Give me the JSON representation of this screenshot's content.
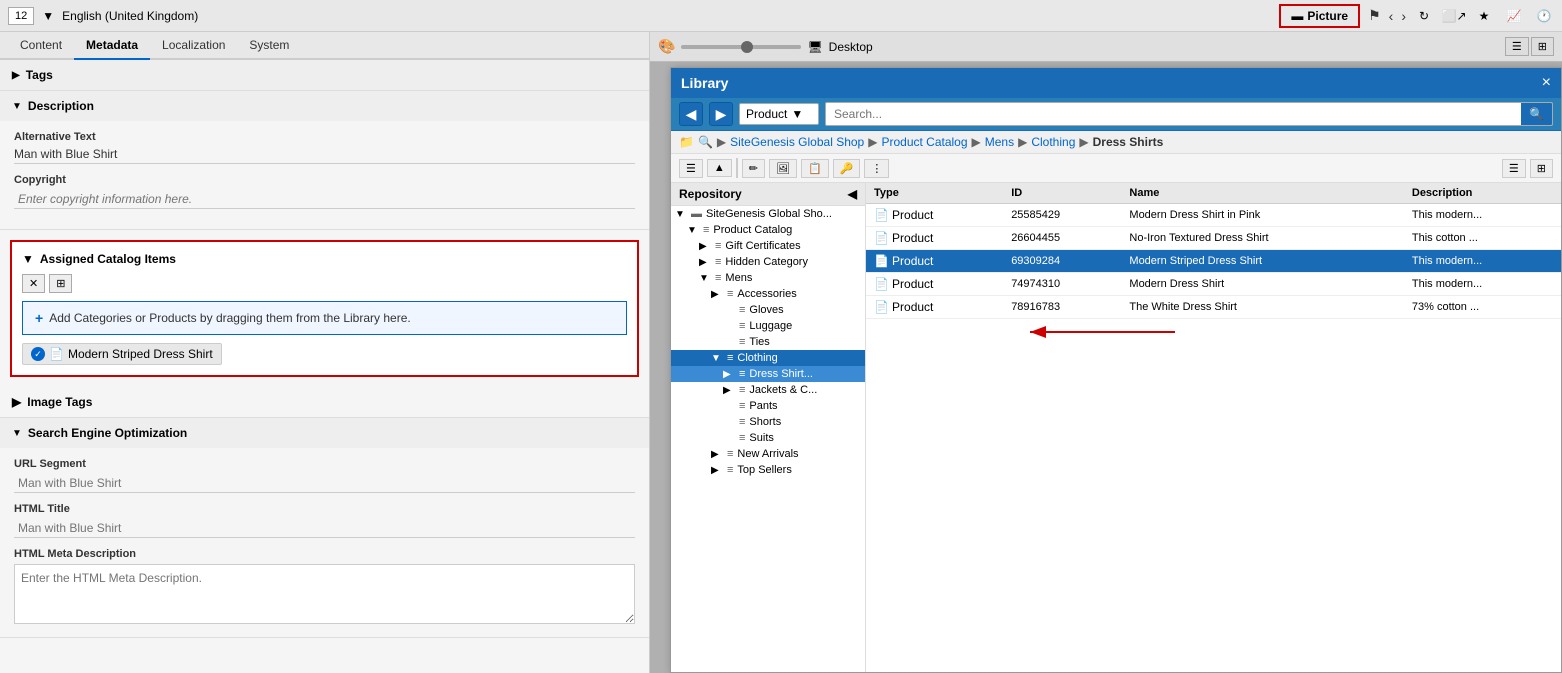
{
  "topbar": {
    "page_num": "12",
    "lang": "English (United Kingdom)",
    "picture_label": "Picture",
    "desktop_label": "Desktop"
  },
  "tabs": {
    "items": [
      "Content",
      "Metadata",
      "Localization",
      "System"
    ],
    "active": "Metadata"
  },
  "tags_section": {
    "label": "Tags",
    "collapsed": true
  },
  "description_section": {
    "label": "Description",
    "alt_text_label": "Alternative Text",
    "alt_text_value": "Man with Blue Shirt",
    "copyright_label": "Copyright",
    "copyright_placeholder": "Enter copyright information here."
  },
  "assigned_catalog": {
    "label": "Assigned Catalog Items",
    "drop_placeholder": "Add Categories or Products by dragging them from the Library here.",
    "tag_label": "Modern Striped Dress Shirt"
  },
  "image_tags": {
    "label": "Image Tags"
  },
  "seo": {
    "label": "Search Engine Optimization",
    "url_segment_label": "URL Segment",
    "url_segment_placeholder": "Man with Blue Shirt",
    "html_title_label": "HTML Title",
    "html_title_placeholder": "Man with Blue Shirt",
    "html_meta_label": "HTML Meta Description",
    "html_meta_placeholder": "Enter the HTML Meta Description."
  },
  "library": {
    "title": "Library",
    "close": "×",
    "search_placeholder": "Search...",
    "dropdown_label": "Product",
    "breadcrumb": [
      "SiteGenesis Global Shop",
      "Product Catalog",
      "Mens",
      "Clothing",
      "Dress Shirts"
    ],
    "repo_header": "Repository",
    "tree": [
      {
        "label": "SiteGenesis Global Sho...",
        "indent": 0,
        "expanded": true,
        "icon": "▼",
        "type": "store"
      },
      {
        "label": "Product Catalog",
        "indent": 1,
        "expanded": true,
        "icon": "▼",
        "type": "list"
      },
      {
        "label": "Gift Certificates",
        "indent": 2,
        "expanded": false,
        "icon": "▶",
        "type": "list"
      },
      {
        "label": "Hidden Category",
        "indent": 2,
        "expanded": false,
        "icon": "▶",
        "type": "list"
      },
      {
        "label": "Mens",
        "indent": 2,
        "expanded": true,
        "icon": "▼",
        "type": "list"
      },
      {
        "label": "Accessories",
        "indent": 3,
        "expanded": false,
        "icon": "▶",
        "type": "list"
      },
      {
        "label": "Gloves",
        "indent": 4,
        "expanded": false,
        "icon": "",
        "type": "list"
      },
      {
        "label": "Luggage",
        "indent": 4,
        "expanded": false,
        "icon": "",
        "type": "list"
      },
      {
        "label": "Ties",
        "indent": 4,
        "expanded": false,
        "icon": "",
        "type": "list"
      },
      {
        "label": "Clothing",
        "indent": 3,
        "expanded": true,
        "icon": "▼",
        "type": "list",
        "selected": true
      },
      {
        "label": "Dress Shirts",
        "indent": 4,
        "expanded": true,
        "icon": "▶",
        "type": "list",
        "active": true
      },
      {
        "label": "Jackets & C...",
        "indent": 4,
        "expanded": false,
        "icon": "▶",
        "type": "list"
      },
      {
        "label": "Pants",
        "indent": 4,
        "expanded": false,
        "icon": "",
        "type": "list"
      },
      {
        "label": "Shorts",
        "indent": 4,
        "expanded": false,
        "icon": "",
        "type": "list"
      },
      {
        "label": "Suits",
        "indent": 4,
        "expanded": false,
        "icon": "",
        "type": "list"
      },
      {
        "label": "New Arrivals",
        "indent": 3,
        "expanded": false,
        "icon": "▶",
        "type": "list"
      },
      {
        "label": "Top Sellers",
        "indent": 3,
        "expanded": false,
        "icon": "▶",
        "type": "list"
      }
    ],
    "columns": [
      "Type",
      "ID",
      "Name",
      "Description"
    ],
    "files": [
      {
        "type": "Product",
        "id": "25585429",
        "name": "Modern Dress Shirt in Pink",
        "desc": "This modern...",
        "selected": false
      },
      {
        "type": "Product",
        "id": "26604455",
        "name": "No-Iron Textured Dress Shirt",
        "desc": "This cotton ...",
        "selected": false
      },
      {
        "type": "Product",
        "id": "69309284",
        "name": "Modern Striped Dress Shirt",
        "desc": "This modern...",
        "selected": true
      },
      {
        "type": "Product",
        "id": "74974310",
        "name": "Modern Dress Shirt",
        "desc": "This modern...",
        "selected": false
      },
      {
        "type": "Product",
        "id": "78916783",
        "name": "The White Dress Shirt",
        "desc": "73% cotton ...",
        "selected": false
      }
    ]
  },
  "colors": {
    "accent_blue": "#1a6bb5",
    "red_border": "#cc0000",
    "selected_row": "#1a6bb5"
  }
}
